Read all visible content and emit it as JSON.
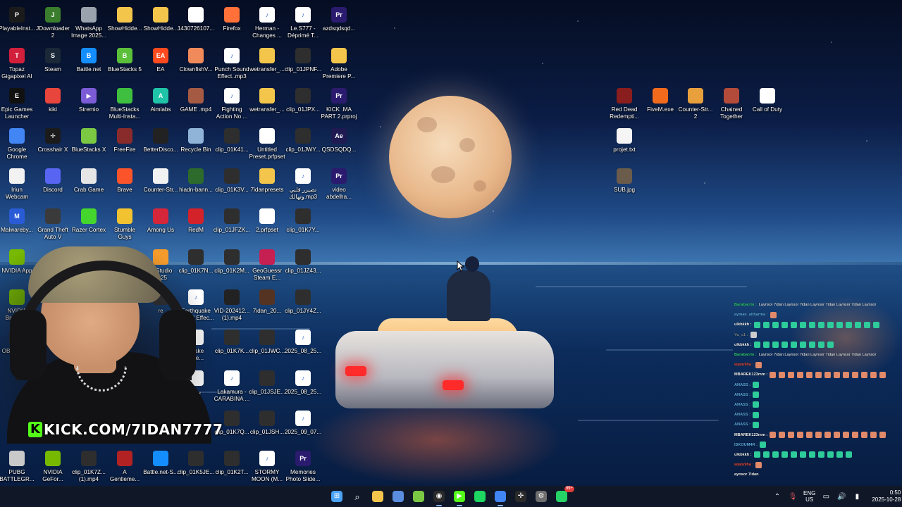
{
  "desktop": {
    "icons": [
      {
        "label": "PlayableInst...",
        "icon": "app-icon",
        "color": "#1b1b1b",
        "glyph": "P"
      },
      {
        "label": "JDownloader\n2",
        "icon": "jdownloader-icon",
        "color": "#3a7d2c",
        "glyph": "J"
      },
      {
        "label": "WhatsApp\nImage 2025...",
        "icon": "image-file-icon",
        "color": "#9aa3ad",
        "glyph": ""
      },
      {
        "label": "ShowHidde...",
        "icon": "folder-icon",
        "color": "#f3c64b",
        "glyph": ""
      },
      {
        "label": "ShowHidde...",
        "icon": "folder-icon",
        "color": "#f3c64b",
        "glyph": ""
      },
      {
        "label": "1430726107...",
        "icon": "file-icon",
        "color": "#ffffff",
        "glyph": ""
      },
      {
        "label": "Firefox",
        "icon": "firefox-icon",
        "color": "#ff7139",
        "glyph": ""
      },
      {
        "label": "Herman -\nChanges ...",
        "icon": "audio-file-icon",
        "color": "#ffffff",
        "glyph": "♪"
      },
      {
        "label": "Le.S777 -\nDéprimé T...",
        "icon": "audio-file-icon",
        "color": "#ffffff",
        "glyph": "♪"
      },
      {
        "label": "azdsqdsqd...",
        "icon": "premiere-project-icon",
        "color": "#2a1b6e",
        "glyph": "Pr"
      },
      {
        "label": "Topaz\nGigapixel AI",
        "icon": "topaz-icon",
        "color": "#d21f3c",
        "glyph": "T"
      },
      {
        "label": "Steam",
        "icon": "steam-icon",
        "color": "#1b2838",
        "glyph": "S"
      },
      {
        "label": "Battle.net",
        "icon": "battlenet-icon",
        "color": "#148eff",
        "glyph": "B"
      },
      {
        "label": "BlueStacks 5",
        "icon": "bluestacks-icon",
        "color": "#5bbf3a",
        "glyph": "B"
      },
      {
        "label": "EA",
        "icon": "ea-icon",
        "color": "#ff4a1f",
        "glyph": "EA"
      },
      {
        "label": "ClownfishV...",
        "icon": "clownfish-icon",
        "color": "#f08a5a",
        "glyph": ""
      },
      {
        "label": "Punch Sound\nEffect..mp3",
        "icon": "audio-file-icon",
        "color": "#ffffff",
        "glyph": "♪"
      },
      {
        "label": "wetransfer_...",
        "icon": "folder-icon",
        "color": "#f3c64b",
        "glyph": ""
      },
      {
        "label": "clip_01JPNF...",
        "icon": "video-file-icon",
        "color": "#2e2e2e",
        "glyph": ""
      },
      {
        "label": "Adobe\nPremiere P...",
        "icon": "zip-folder-icon",
        "color": "#f3c64b",
        "glyph": ""
      },
      {
        "label": "Epic Games\nLauncher",
        "icon": "epic-games-icon",
        "color": "#111111",
        "glyph": "E"
      },
      {
        "label": "kiki",
        "icon": "chrome-icon",
        "color": "#e8453c",
        "glyph": ""
      },
      {
        "label": "Stremio",
        "icon": "stremio-icon",
        "color": "#7b5bd6",
        "glyph": "▶"
      },
      {
        "label": "BlueStacks\nMulti-Insta...",
        "icon": "bluestacks-multi-icon",
        "color": "#3fbf3f",
        "glyph": ""
      },
      {
        "label": "Aimlabs",
        "icon": "aimlabs-icon",
        "color": "#1fc3a8",
        "glyph": "A"
      },
      {
        "label": "GAME .mp4",
        "icon": "video-file-icon",
        "color": "#a55a44",
        "glyph": ""
      },
      {
        "label": "Fighting\nAction No ...",
        "icon": "audio-file-icon",
        "color": "#ffffff",
        "glyph": "♪"
      },
      {
        "label": "wetransfer_...",
        "icon": "zip-folder-icon",
        "color": "#f3c64b",
        "glyph": ""
      },
      {
        "label": "clip_01JPX...",
        "icon": "video-file-icon",
        "color": "#2e2e2e",
        "glyph": ""
      },
      {
        "label": "KICK .MA\nPART 2.prproj",
        "icon": "premiere-project-icon",
        "color": "#2a1b6e",
        "glyph": "Pr"
      },
      {
        "label": "Google\nChrome",
        "icon": "chrome-icon",
        "color": "#4285f4",
        "glyph": ""
      },
      {
        "label": "Crosshair X",
        "icon": "crosshair-icon",
        "color": "#1b1b1b",
        "glyph": "✛"
      },
      {
        "label": "BlueStacks X",
        "icon": "bluestacks-x-icon",
        "color": "#7bc943",
        "glyph": ""
      },
      {
        "label": "FreeFire",
        "icon": "freefire-icon",
        "color": "#8a2b2b",
        "glyph": ""
      },
      {
        "label": "BetterDisco...",
        "icon": "betterdiscord-icon",
        "color": "#222222",
        "glyph": ""
      },
      {
        "label": "Recycle Bin",
        "icon": "recycle-bin-icon",
        "color": "#8fb4d8",
        "glyph": ""
      },
      {
        "label": "clip_01K41...",
        "icon": "video-file-icon",
        "color": "#2e2e2e",
        "glyph": ""
      },
      {
        "label": "Untitled\nPreset.prfpset",
        "icon": "preset-file-icon",
        "color": "#ffffff",
        "glyph": ""
      },
      {
        "label": "clip_01JWY...",
        "icon": "video-file-icon",
        "color": "#2e2e2e",
        "glyph": ""
      },
      {
        "label": "QSDSQDQ...",
        "icon": "after-effects-icon",
        "color": "#1f1a52",
        "glyph": "Ae"
      },
      {
        "label": "Iriun\nWebcam",
        "icon": "webcam-icon",
        "color": "#f2f2f2",
        "glyph": ""
      },
      {
        "label": "Discord",
        "icon": "discord-icon",
        "color": "#5865f2",
        "glyph": ""
      },
      {
        "label": "Crab Game",
        "icon": "crab-game-icon",
        "color": "#e6e6e6",
        "glyph": ""
      },
      {
        "label": "Brave",
        "icon": "brave-icon",
        "color": "#fb542b",
        "glyph": ""
      },
      {
        "label": "Counter-Str...",
        "icon": "counter-strike-icon",
        "color": "#f2f2f2",
        "glyph": ""
      },
      {
        "label": "hiadn-bann...",
        "icon": "image-file-icon",
        "color": "#2c6b2c",
        "glyph": ""
      },
      {
        "label": "clip_01K3V...",
        "icon": "video-file-icon",
        "color": "#2e2e2e",
        "glyph": ""
      },
      {
        "label": "7idanpresets",
        "icon": "folder-icon",
        "color": "#f3c64b",
        "glyph": ""
      },
      {
        "label": "تصيرر قلبي\nوتهالك.mp3",
        "icon": "audio-file-icon",
        "color": "#ffffff",
        "glyph": "♪"
      },
      {
        "label": "video\nabdelha...",
        "icon": "premiere-project-icon",
        "color": "#2a1b6e",
        "glyph": "Pr"
      },
      {
        "label": "Malwareby...",
        "icon": "malwarebytes-icon",
        "color": "#2a5bd7",
        "glyph": "M"
      },
      {
        "label": "Grand Theft\nAuto V",
        "icon": "gta-icon",
        "color": "#3a3a3a",
        "glyph": ""
      },
      {
        "label": "Razer Cortex",
        "icon": "razer-icon",
        "color": "#44d62c",
        "glyph": ""
      },
      {
        "label": "Stumble\nGuys",
        "icon": "stumble-guys-icon",
        "color": "#f2c230",
        "glyph": ""
      },
      {
        "label": "Among Us",
        "icon": "among-us-icon",
        "color": "#d6263a",
        "glyph": ""
      },
      {
        "label": "RedM",
        "icon": "redm-icon",
        "color": "#d3222a",
        "glyph": ""
      },
      {
        "label": "clip_01JFZK...",
        "icon": "video-file-icon",
        "color": "#2e2e2e",
        "glyph": ""
      },
      {
        "label": "2.prfpset",
        "icon": "preset-file-icon",
        "color": "#ffffff",
        "glyph": ""
      },
      {
        "label": "clip_01K7Y...",
        "icon": "video-file-icon",
        "color": "#2e2e2e",
        "glyph": ""
      },
      {
        "label": "NVIDIA App",
        "icon": "nvidia-icon",
        "color": "#76b900",
        "glyph": ""
      },
      {
        "label": "era GX",
        "icon": "opera-gx-icon",
        "color": "#c7265b",
        "glyph": ""
      },
      {
        "label": "FLStudio\n2025",
        "icon": "flstudio-icon",
        "color": "#f49b2c",
        "glyph": ""
      },
      {
        "label": "clip_01K7N...",
        "icon": "video-file-icon",
        "color": "#2e2e2e",
        "glyph": ""
      },
      {
        "label": "clip_01K2M...",
        "icon": "video-file-icon",
        "color": "#2e2e2e",
        "glyph": ""
      },
      {
        "label": "GeoGuessr\nSteam E...",
        "icon": "geoguessr-icon",
        "color": "#c61f52",
        "glyph": ""
      },
      {
        "label": "clip_01JZ43...",
        "icon": "video-file-icon",
        "color": "#2e2e2e",
        "glyph": ""
      },
      {
        "label": "NVIDIA\nBroadc...",
        "icon": "nvidia-broadcast-icon",
        "color": "#76b900",
        "glyph": ""
      },
      {
        "label": "re",
        "icon": "app-icon",
        "color": "#333333",
        "glyph": ""
      },
      {
        "label": "Earthquake\nSound Effec...",
        "icon": "audio-file-icon",
        "color": "#ffffff",
        "glyph": "♪"
      },
      {
        "label": "VID-202412...\n(1).mp4",
        "icon": "video-file-icon",
        "color": "#222222",
        "glyph": ""
      },
      {
        "label": "7idan_20...",
        "icon": "video-file-icon",
        "color": "#553322",
        "glyph": ""
      },
      {
        "label": "clip_01JY4Z...",
        "icon": "video-file-icon",
        "color": "#2e2e2e",
        "glyph": ""
      },
      {
        "label": "OBS Studio",
        "icon": "obs-icon",
        "color": "#2a2a2a",
        "glyph": "◉"
      },
      {
        "label": "quake\nscre...",
        "icon": "audio-file-icon",
        "color": "#ffffff",
        "glyph": ""
      },
      {
        "label": "clip_01K7K...",
        "icon": "video-file-icon",
        "color": "#2e2e2e",
        "glyph": ""
      },
      {
        "label": "clip_01JWC...",
        "icon": "video-file-icon",
        "color": "#2e2e2e",
        "glyph": ""
      },
      {
        "label": "2025_08_25...",
        "icon": "audio-file-icon",
        "color": "#ffffff",
        "glyph": "♪"
      },
      {
        "label": "بوت",
        "icon": "file-icon",
        "color": "#ffffff",
        "glyph": ""
      },
      {
        "label": "Lakamura -\nCARABINA ...",
        "icon": "audio-file-icon",
        "color": "#ffffff",
        "glyph": "♪"
      },
      {
        "label": "clip_01JSJE...",
        "icon": "video-file-icon",
        "color": "#2e2e2e",
        "glyph": ""
      },
      {
        "label": "2025_08_25...",
        "icon": "audio-file-icon",
        "color": "#ffffff",
        "glyph": "♪"
      },
      {
        "label": "clip_01K7Q...",
        "icon": "video-file-icon",
        "color": "#2e2e2e",
        "glyph": ""
      },
      {
        "label": "clip_01JSH...",
        "icon": "video-file-icon",
        "color": "#2e2e2e",
        "glyph": ""
      },
      {
        "label": "2025_09_07...",
        "icon": "audio-file-icon",
        "color": "#ffffff",
        "glyph": "♪"
      },
      {
        "label": "PUBG\nBATTLEGR...",
        "icon": "pubg-icon",
        "color": "#c9c9c9",
        "glyph": ""
      },
      {
        "label": "NVIDIA\nGeFor...",
        "icon": "nvidia-geforce-icon",
        "color": "#76b900",
        "glyph": ""
      },
      {
        "label": "clip_01K7Z...\n(1).mp4",
        "icon": "video-file-icon",
        "color": "#2e2e2e",
        "glyph": ""
      },
      {
        "label": "A\nGentleme...",
        "icon": "file-icon",
        "color": "#b22222",
        "glyph": ""
      },
      {
        "label": "Battle.net-S...",
        "icon": "battlenet-icon",
        "color": "#148eff",
        "glyph": ""
      },
      {
        "label": "clip_01K5JE...",
        "icon": "video-file-icon",
        "color": "#2e2e2e",
        "glyph": ""
      },
      {
        "label": "clip_01K2T...",
        "icon": "video-file-icon",
        "color": "#2e2e2e",
        "glyph": ""
      },
      {
        "label": "STORMY\nMOON (M...",
        "icon": "audio-file-icon",
        "color": "#ffffff",
        "glyph": "♪"
      },
      {
        "label": "Memories\nPhoto Slide...",
        "icon": "premiere-project-icon",
        "color": "#2a1b6e",
        "glyph": "Pr"
      },
      {
        "label": "Red Dead\nRedempti...",
        "icon": "red-dead-icon",
        "color": "#8a1d1d",
        "glyph": ""
      },
      {
        "label": "FiveM.exe",
        "icon": "fivem-icon",
        "color": "#f26b1d",
        "glyph": ""
      },
      {
        "label": "Counter-Str...\n2",
        "icon": "cs2-icon",
        "color": "#e8a03c",
        "glyph": ""
      },
      {
        "label": "Chained\nTogether",
        "icon": "chained-together-icon",
        "color": "#b24b3a",
        "glyph": ""
      },
      {
        "label": "Call of Duty",
        "icon": "file-icon",
        "color": "#ffffff",
        "glyph": ""
      },
      {
        "label": "projet.txt",
        "icon": "text-file-icon",
        "color": "#f5f5f5",
        "glyph": ""
      },
      {
        "label": "SUB.jpg",
        "icon": "image-file-icon",
        "color": "#6b5b4b",
        "glyph": ""
      }
    ]
  },
  "stream": {
    "kick_logo": "K",
    "kick_url": "KICK.COM/7IDAN7777",
    "kick_color": "#53fc18"
  },
  "chat": [
    {
      "user": "Barabarrio :",
      "msg": "Laynsor 7idan Laynsor 7idan Laynsor 7idan Laynsor 7idan Laynsor",
      "color": "#2ecc71",
      "emotes": 0,
      "emote_color": ""
    },
    {
      "user": "ayman_altharma :",
      "msg": "",
      "color": "#5dade2",
      "emotes": 1,
      "emote_color": "#e08a6a"
    },
    {
      "user": "ulkbkkh :",
      "msg": "",
      "color": "#f2f2f2",
      "emotes": 14,
      "emote_color": "#2ecc9a"
    },
    {
      "user": "Yu_c1 :",
      "msg": "",
      "color": "#7f8c8d",
      "emotes": 1,
      "emote_color": "#cccccc"
    },
    {
      "user": "ulkbkkh :",
      "msg": "",
      "color": "#f2f2f2",
      "emotes": 9,
      "emote_color": "#2ecc9a"
    },
    {
      "user": "Barabarrio :",
      "msg": "Laynsor 7idan Laynsor 7idan Laynsor 7idan Laynsor 7idan Laynsor",
      "color": "#2ecc71",
      "emotes": 0,
      "emote_color": ""
    },
    {
      "user": "wjatu9ha :",
      "msg": "",
      "color": "#e74c3c",
      "emotes": 1,
      "emote_color": "#e08a6a"
    },
    {
      "user": "MBAREK123mm :",
      "msg": "",
      "color": "#f2f2f2",
      "emotes": 13,
      "emote_color": "#e08a6a"
    },
    {
      "user": "ANASS :",
      "msg": "",
      "color": "#5dade2",
      "emotes": 1,
      "emote_color": "#2ecc9a"
    },
    {
      "user": "ANASS :",
      "msg": "",
      "color": "#5dade2",
      "emotes": 1,
      "emote_color": "#2ecc9a"
    },
    {
      "user": "ANASS :",
      "msg": "",
      "color": "#5dade2",
      "emotes": 1,
      "emote_color": "#2ecc9a"
    },
    {
      "user": "ANASS :",
      "msg": "",
      "color": "#5dade2",
      "emotes": 1,
      "emote_color": "#2ecc9a"
    },
    {
      "user": "ANASS :",
      "msg": "",
      "color": "#5dade2",
      "emotes": 1,
      "emote_color": "#2ecc9a"
    },
    {
      "user": "MBAREK123mm :",
      "msg": "",
      "color": "#f2f2f2",
      "emotes": 13,
      "emote_color": "#e08a6a"
    },
    {
      "user": "ISKOUM4R :",
      "msg": "",
      "color": "#5dade2",
      "emotes": 1,
      "emote_color": "#2ecc9a"
    },
    {
      "user": "ulkbkkh :",
      "msg": "",
      "color": "#f2f2f2",
      "emotes": 11,
      "emote_color": "#2ecc9a"
    },
    {
      "user": "wjatu9ha :",
      "msg": "",
      "color": "#e74c3c",
      "emotes": 1,
      "emote_color": "#e08a6a"
    },
    {
      "user": "aynsor 7idan",
      "msg": "",
      "color": "#f2f2f2",
      "emotes": 0,
      "emote_color": ""
    }
  ],
  "taskbar": {
    "apps": [
      {
        "name": "start-button",
        "icon": "windows-icon",
        "color": "#4ba3f5",
        "glyph": "⊞",
        "active": false,
        "badge": ""
      },
      {
        "name": "search-button",
        "icon": "search-icon",
        "color": "",
        "glyph": "⌕",
        "active": false,
        "badge": ""
      },
      {
        "name": "file-explorer-button",
        "icon": "folder-icon",
        "color": "#f3c64b",
        "glyph": "",
        "active": false,
        "badge": ""
      },
      {
        "name": "store-button",
        "icon": "store-icon",
        "color": "#5a8de0",
        "glyph": "",
        "active": false,
        "badge": ""
      },
      {
        "name": "bluestacks-button",
        "icon": "bluestacks-icon",
        "color": "#7bc943",
        "glyph": "",
        "active": false,
        "badge": ""
      },
      {
        "name": "obs-button",
        "icon": "obs-icon",
        "color": "#2a2a2a",
        "glyph": "◉",
        "active": true,
        "badge": ""
      },
      {
        "name": "kick-button",
        "icon": "play-icon",
        "color": "#53fc18",
        "glyph": "▶",
        "active": true,
        "badge": ""
      },
      {
        "name": "spotify-button",
        "icon": "spotify-icon",
        "color": "#1ed760",
        "glyph": "",
        "active": false,
        "badge": ""
      },
      {
        "name": "chrome-button",
        "icon": "chrome-icon",
        "color": "#4285f4",
        "glyph": "",
        "active": true,
        "badge": ""
      },
      {
        "name": "crosshair-button",
        "icon": "crosshair-icon",
        "color": "#2a2a2a",
        "glyph": "✛",
        "active": false,
        "badge": ""
      },
      {
        "name": "settings-button",
        "icon": "gear-icon",
        "color": "#6e6e6e",
        "glyph": "⚙",
        "active": false,
        "badge": ""
      },
      {
        "name": "whatsapp-button",
        "icon": "whatsapp-icon",
        "color": "#25d366",
        "glyph": "",
        "active": false,
        "badge": "99+"
      }
    ],
    "tray": {
      "lang_line1": "ENG",
      "lang_line2": "US",
      "time": "0:50",
      "date": "2025-10-28"
    }
  }
}
